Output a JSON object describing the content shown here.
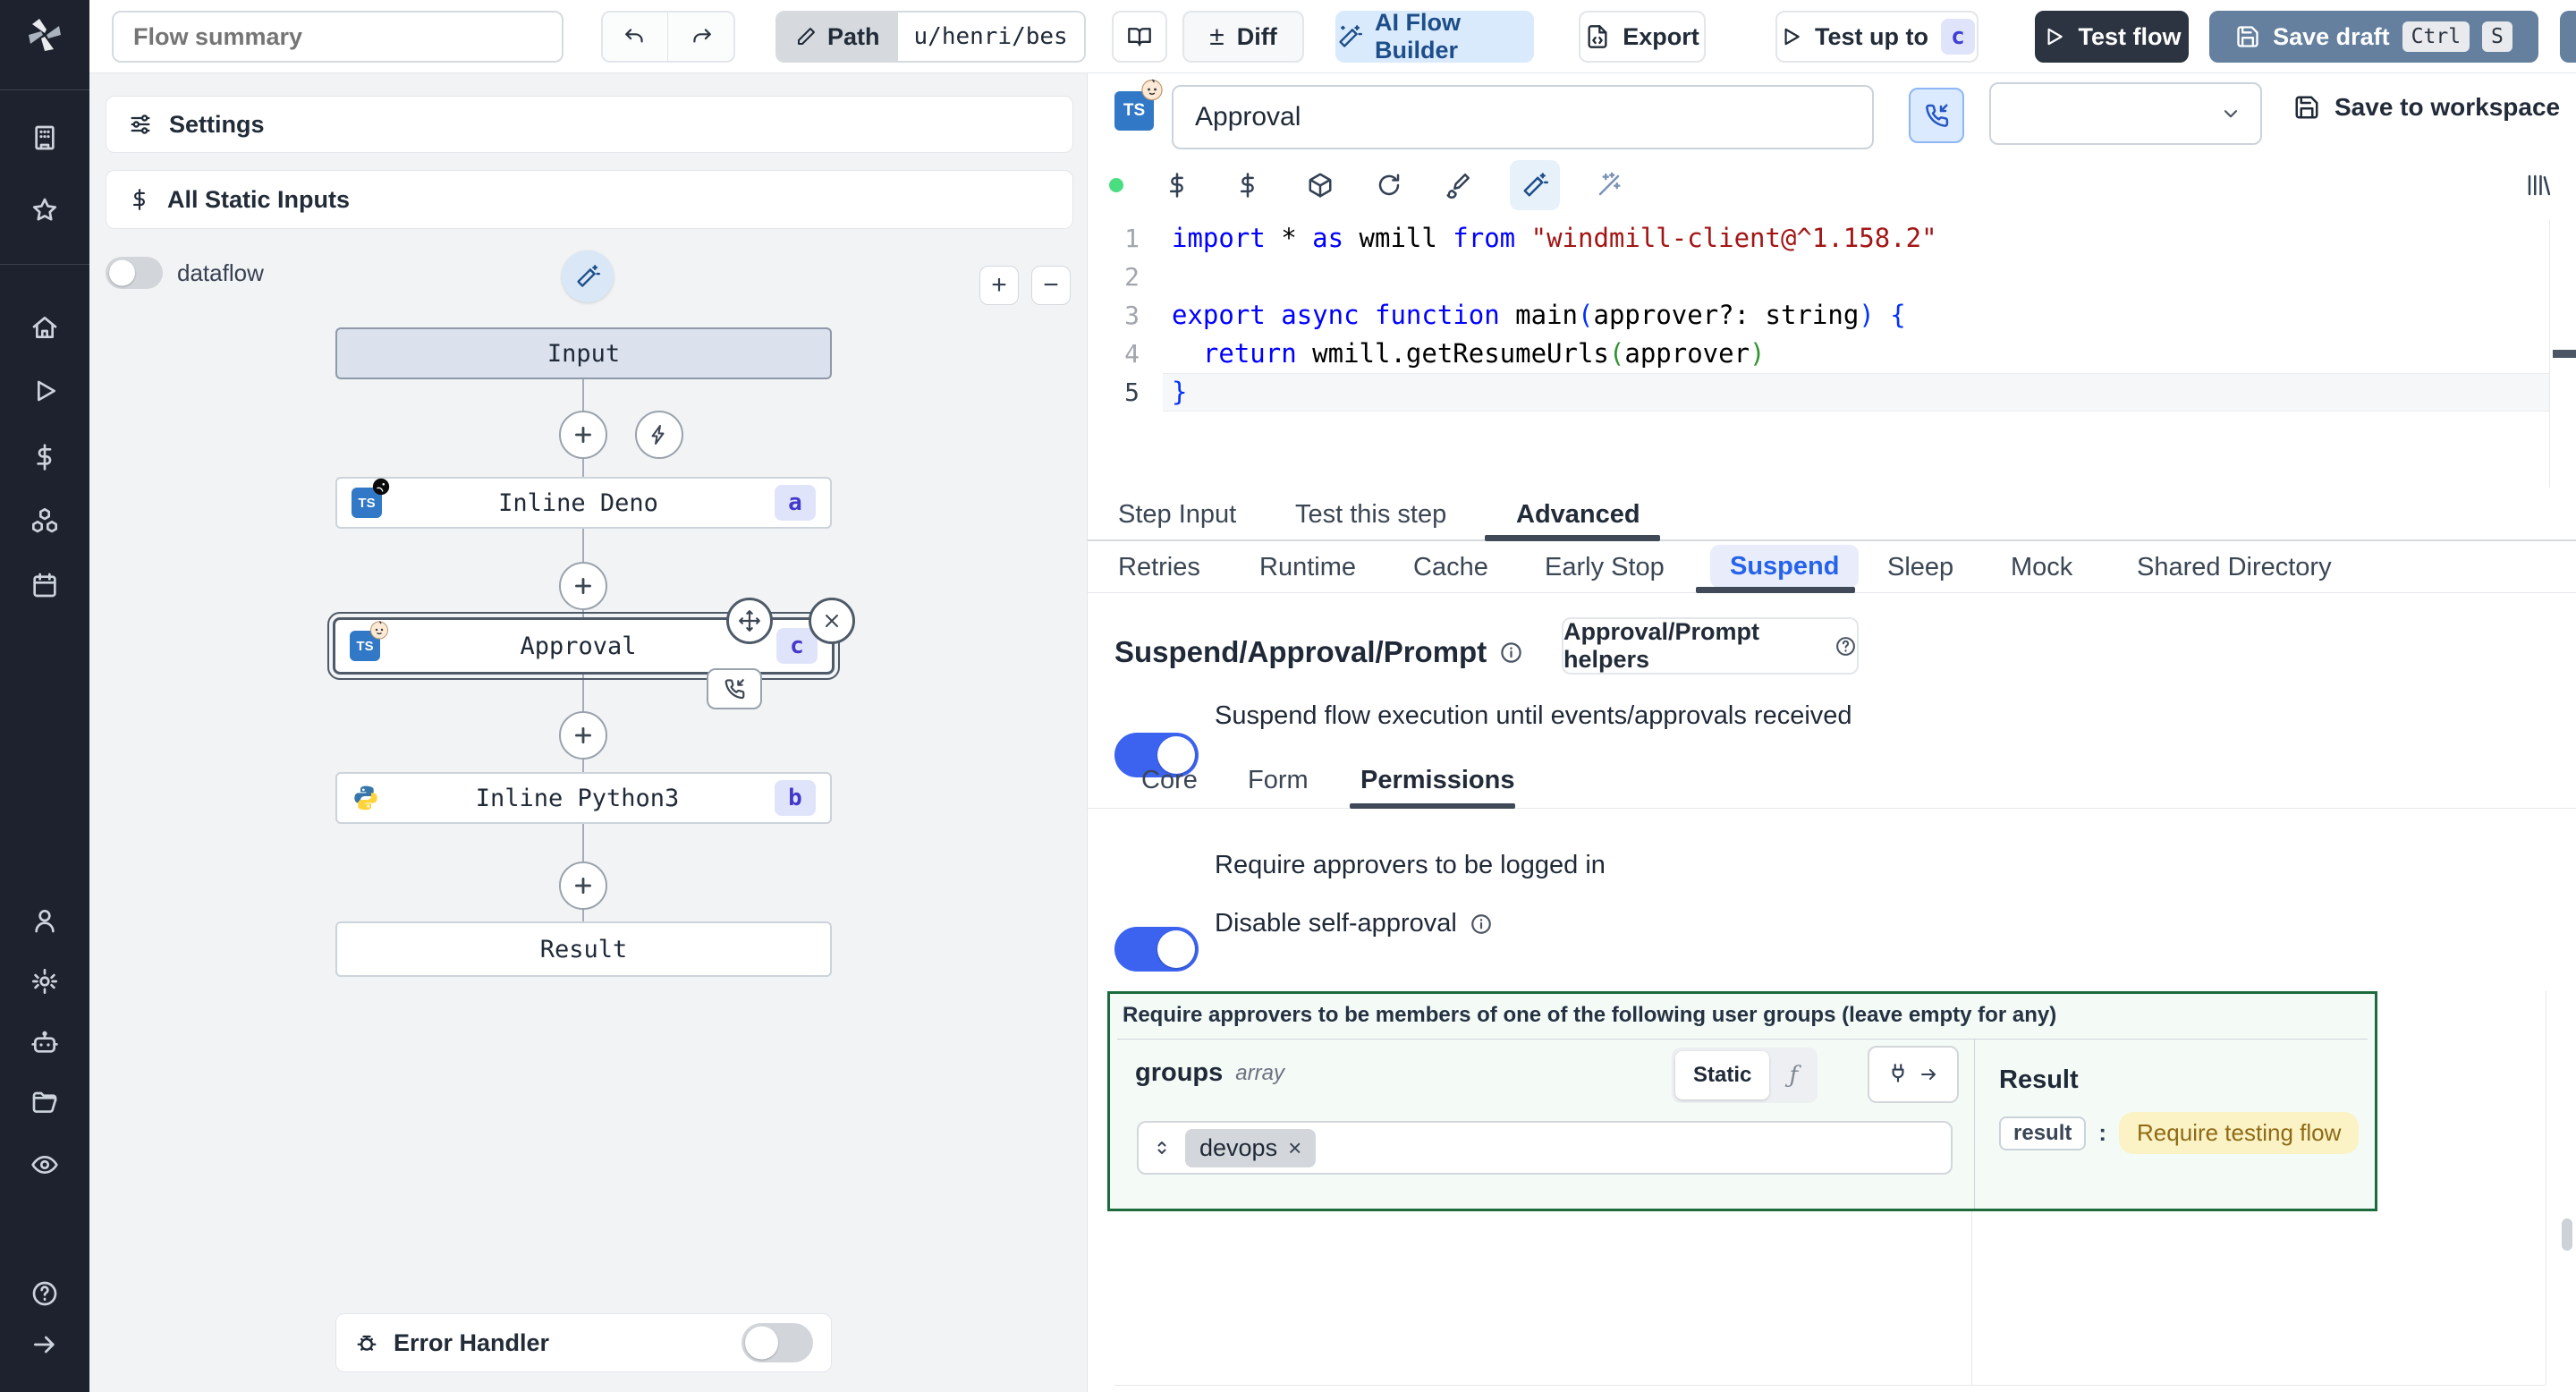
{
  "toolbar": {
    "flow_summary_placeholder": "Flow summary",
    "path_label": "Path",
    "path_value": "u/henri/bes",
    "plus_minus": "±",
    "diff_label": "Diff",
    "ai_flow_builder_label": "AI Flow Builder",
    "export_label": "Export",
    "test_up_to_label": "Test up to",
    "test_up_to_badge": "c",
    "test_flow_label": "Test flow",
    "save_draft_label": "Save draft",
    "kbd_ctrl": "Ctrl",
    "kbd_s": "S"
  },
  "flow_panel": {
    "settings_label": "Settings",
    "all_static_inputs_label": "All Static Inputs",
    "dataflow_label": "dataflow",
    "zoom_in": "+",
    "zoom_out": "−",
    "nodes": {
      "input_label": "Input",
      "deno_label": "Inline Deno",
      "deno_badge": "a",
      "approval_label": "Approval",
      "approval_badge": "c",
      "python_label": "Inline Python3",
      "python_badge": "b",
      "result_label": "Result"
    },
    "error_handler_label": "Error Handler"
  },
  "step_editor": {
    "title_value": "Approval",
    "save_to_workspace_label": "Save to workspace",
    "code": {
      "active_line": 5,
      "lines": [
        [
          [
            "kw",
            "import"
          ],
          [
            "pl",
            " * "
          ],
          [
            "kw",
            "as"
          ],
          [
            "pl",
            " wmill "
          ],
          [
            "kw",
            "from"
          ],
          [
            "pl",
            " "
          ],
          [
            "st",
            "\"windmill-client@^1.158.2\""
          ]
        ],
        [],
        [
          [
            "kw",
            "export"
          ],
          [
            "pl",
            " "
          ],
          [
            "kw",
            "async"
          ],
          [
            "pl",
            " "
          ],
          [
            "kw",
            "function"
          ],
          [
            "pl",
            " main"
          ],
          [
            "b1",
            "("
          ],
          [
            "pl",
            "approver?: string"
          ],
          [
            "b1",
            ")"
          ],
          [
            "pl",
            " "
          ],
          [
            "b1",
            "{"
          ]
        ],
        [
          [
            "pl",
            "  "
          ],
          [
            "kw",
            "return"
          ],
          [
            "pl",
            " wmill.getResumeUrls"
          ],
          [
            "b2",
            "("
          ],
          [
            "pl",
            "approver"
          ],
          [
            "b2",
            ")"
          ]
        ],
        [
          [
            "b1",
            "}"
          ]
        ]
      ]
    },
    "tabs": [
      "Step Input",
      "Test this step",
      "Advanced"
    ],
    "advanced_tabs": [
      "Retries",
      "Runtime",
      "Cache",
      "Early Stop",
      "Suspend",
      "Sleep",
      "Mock",
      "Shared Directory"
    ],
    "suspend": {
      "heading": "Suspend/Approval/Prompt",
      "helpers_button_label": "Approval/Prompt helpers",
      "suspend_toggle_label": "Suspend flow execution until events/approvals received",
      "sub_tabs": [
        "Core",
        "Form",
        "Permissions"
      ],
      "require_login_label": "Require approvers to be logged in",
      "disable_self_approval_label": "Disable self-approval",
      "groups_box": {
        "header": "Require approvers to be members of one of the following user groups (leave empty for any)",
        "field_name": "groups",
        "field_type": "array",
        "static_label": "Static",
        "chip_label": "devops",
        "colon": ":",
        "result_title": "Result",
        "result_key": "result",
        "result_value": "Require testing flow"
      }
    }
  },
  "icons": {
    "ts": "TS",
    "function_glyph": "ƒ",
    "close_glyph": "×"
  },
  "colors": {
    "toggle_on": "#3b63f0",
    "ai_button_bg": "#d9eafd",
    "test_flow_bg": "#2b3440",
    "save_draft_bg": "#64809e",
    "badge_bg": "#e0e4fb",
    "badge_text": "#4338ca",
    "green_border": "#1c6b3c",
    "highlight_bg": "#fbf3c6",
    "highlight_text": "#8f6a14",
    "status_dot": "#4ade80"
  }
}
